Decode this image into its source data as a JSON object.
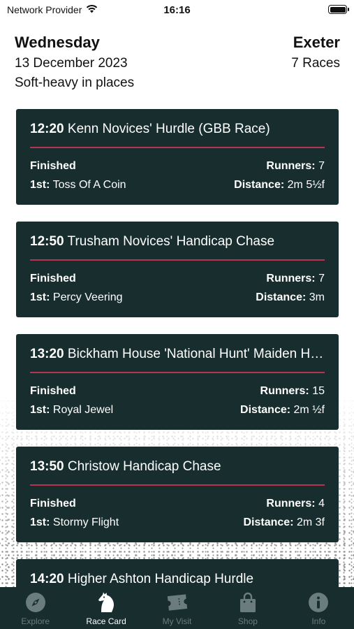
{
  "status_bar": {
    "carrier": "Network Provider",
    "time": "16:16"
  },
  "header": {
    "day": "Wednesday",
    "date": "13 December 2023",
    "going": "Soft-heavy in places",
    "course": "Exeter",
    "race_count": "7 Races"
  },
  "races": [
    {
      "time": "12:20",
      "name": "Kenn Novices' Hurdle (GBB Race)",
      "status": "Finished",
      "runners_label": "Runners:",
      "runners": "7",
      "first_label": "1st:",
      "winner": "Toss Of A Coin",
      "distance_label": "Distance:",
      "distance": "2m 5½f"
    },
    {
      "time": "12:50",
      "name": "Trusham Novices' Handicap Chase",
      "status": "Finished",
      "runners_label": "Runners:",
      "runners": "7",
      "first_label": "1st:",
      "winner": "Percy Veering",
      "distance_label": "Distance:",
      "distance": "3m"
    },
    {
      "time": "13:20",
      "name": "Bickham House 'National Hunt' Maiden Hurdle",
      "status": "Finished",
      "runners_label": "Runners:",
      "runners": "15",
      "first_label": "1st:",
      "winner": "Royal Jewel",
      "distance_label": "Distance:",
      "distance": "2m ½f"
    },
    {
      "time": "13:50",
      "name": "Christow Handicap Chase",
      "status": "Finished",
      "runners_label": "Runners:",
      "runners": "4",
      "first_label": "1st:",
      "winner": "Stormy Flight",
      "distance_label": "Distance:",
      "distance": "2m 3f"
    },
    {
      "time": "14:20",
      "name": "Higher Ashton Handicap Hurdle"
    }
  ],
  "tabs": [
    {
      "label": "Explore",
      "icon": "compass-icon",
      "active": false
    },
    {
      "label": "Race Card",
      "icon": "horse-head-icon",
      "active": true
    },
    {
      "label": "My Visit",
      "icon": "ticket-icon",
      "active": false
    },
    {
      "label": "Shop",
      "icon": "shopping-bag-icon",
      "active": false
    },
    {
      "label": "Info",
      "icon": "info-icon",
      "active": false
    }
  ],
  "colors": {
    "card_bg": "#172d2e",
    "divider": "#b5344f",
    "tab_inactive": "#6b7c7c"
  }
}
